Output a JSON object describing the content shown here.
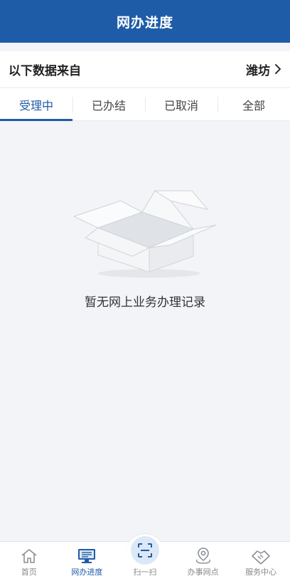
{
  "header": {
    "title": "网办进度"
  },
  "source": {
    "label": "以下数据来自",
    "city": "潍坊"
  },
  "tabs": [
    {
      "label": "受理中",
      "active": true
    },
    {
      "label": "已办结",
      "active": false
    },
    {
      "label": "已取消",
      "active": false
    },
    {
      "label": "全部",
      "active": false
    }
  ],
  "empty": {
    "message": "暂无网上业务办理记录",
    "icon": "empty-box-icon"
  },
  "bottom_nav": [
    {
      "label": "首页",
      "icon": "home-icon",
      "active": false
    },
    {
      "label": "网办进度",
      "icon": "monitor-icon",
      "active": true
    },
    {
      "label": "扫一扫",
      "icon": "scan-icon",
      "active": false
    },
    {
      "label": "办事网点",
      "icon": "location-pin-icon",
      "active": false
    },
    {
      "label": "服务中心",
      "icon": "handshake-icon",
      "active": false
    }
  ],
  "colors": {
    "primary": "#1f5ca8",
    "background": "#f2f4f7"
  }
}
